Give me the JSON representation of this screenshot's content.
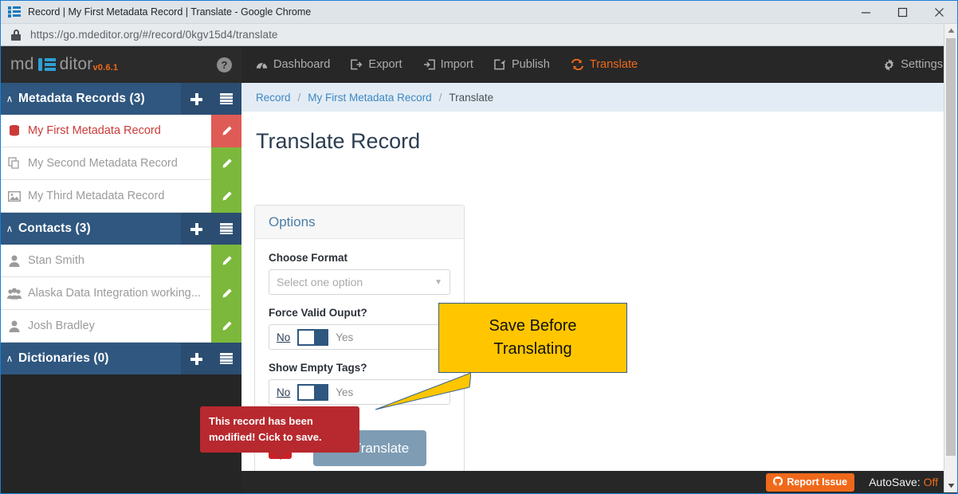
{
  "browser": {
    "tab_title": "Record | My First Metadata Record | Translate - Google Chrome",
    "url": "https://go.mdeditor.org/#/record/0kgv15d4/translate",
    "minimize_label": "Minimize",
    "maximize_label": "Maximize",
    "close_label": "Close"
  },
  "sidebar": {
    "brand": {
      "text_before": "md",
      "text_after": "ditor",
      "version": "v0.6.1"
    },
    "help_glyph": "?",
    "sections": [
      {
        "title": "Metadata Records (3)",
        "caret": "∧",
        "items": [
          {
            "label": "My First Metadata Record",
            "icon": "database-icon",
            "active": true
          },
          {
            "label": "My Second Metadata Record",
            "icon": "copy-icon",
            "active": false
          },
          {
            "label": "My Third Metadata Record",
            "icon": "image-icon",
            "active": false
          }
        ]
      },
      {
        "title": "Contacts (3)",
        "caret": "∧",
        "items": [
          {
            "label": "Stan Smith",
            "icon": "person-icon",
            "active": false
          },
          {
            "label": "Alaska Data Integration working...",
            "icon": "group-icon",
            "active": false
          },
          {
            "label": "Josh Bradley",
            "icon": "person-icon",
            "active": false
          }
        ]
      },
      {
        "title": "Dictionaries (0)",
        "caret": "∧",
        "items": []
      }
    ]
  },
  "topnav": {
    "items": [
      {
        "label": "Dashboard",
        "icon": "dashboard-icon",
        "active": false
      },
      {
        "label": "Export",
        "icon": "export-icon",
        "active": false
      },
      {
        "label": "Import",
        "icon": "import-icon",
        "active": false
      },
      {
        "label": "Publish",
        "icon": "publish-icon",
        "active": false
      },
      {
        "label": "Translate",
        "icon": "translate-icon",
        "active": true
      }
    ],
    "settings": {
      "label": "Settings",
      "icon": "gear-icon"
    }
  },
  "breadcrumb": {
    "root": "Record",
    "record": "My First Metadata Record",
    "current": "Translate",
    "separator": "/"
  },
  "page": {
    "title": "Translate Record"
  },
  "options_card": {
    "header": "Options",
    "format": {
      "label": "Choose Format",
      "placeholder": "Select one option",
      "value": ""
    },
    "force_valid": {
      "label": "Force Valid Ouput?",
      "off_label": "No",
      "on_label": "Yes",
      "selected": "No"
    },
    "show_empty": {
      "label": "Show Empty Tags?",
      "off_label": "No",
      "on_label": "Yes",
      "selected": "No"
    },
    "warn_button": {
      "glyph": "!",
      "name": "unsaved-changes-button"
    },
    "translate_button": {
      "label": "Translate",
      "icon": "translate-icon",
      "disabled": true
    }
  },
  "tooltip": {
    "text": "This record has been modified! Cick to save."
  },
  "callout": {
    "line1": "Save Before",
    "line2": "Translating"
  },
  "footer": {
    "report_issue": "Report Issue",
    "autosave_label": "AutoSave:",
    "autosave_value": "Off"
  },
  "colors": {
    "accent_orange": "#f0691a",
    "section_blue": "#2f577f",
    "edit_green": "#7cb83b",
    "edit_red": "#df5b56",
    "warn_red": "#b7292e",
    "callout_yellow": "#ffc600",
    "link_blue": "#3d87c4"
  }
}
